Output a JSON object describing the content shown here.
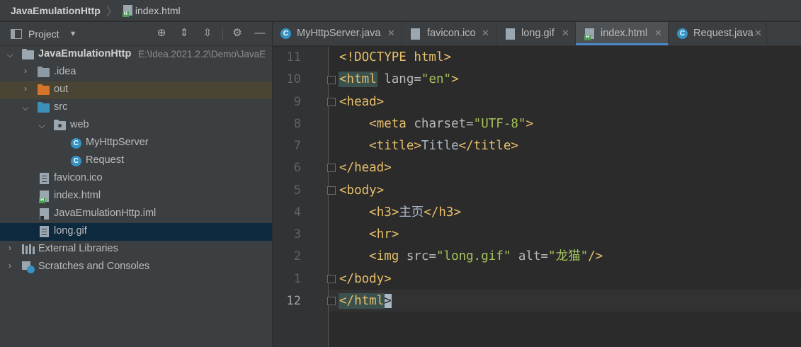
{
  "breadcrumb": {
    "project": "JavaEmulationHttp",
    "file": "index.html"
  },
  "project_panel": {
    "title": "Project",
    "tools": [
      "locate-icon",
      "expand-all-icon",
      "collapse-all-icon",
      "gear-icon",
      "minimize-icon"
    ],
    "root": {
      "name": "JavaEmulationHttp",
      "path": "E:\\Idea.2021.2.2\\Demo\\JavaE"
    },
    "items": [
      {
        "label": ".idea",
        "icon": "folder-icon"
      },
      {
        "label": "out",
        "icon": "folder-excluded-icon"
      },
      {
        "label": "src",
        "icon": "folder-source-icon"
      },
      {
        "label": "web",
        "icon": "package-icon"
      },
      {
        "label": "MyHttpServer",
        "icon": "java-class-icon"
      },
      {
        "label": "Request",
        "icon": "java-class-icon"
      },
      {
        "label": "favicon.ico",
        "icon": "image-file-icon"
      },
      {
        "label": "index.html",
        "icon": "html-file-icon"
      },
      {
        "label": "JavaEmulationHttp.iml",
        "icon": "module-file-icon"
      },
      {
        "label": "long.gif",
        "icon": "image-file-icon"
      },
      {
        "label": "External Libraries",
        "icon": "libraries-icon"
      },
      {
        "label": "Scratches and Consoles",
        "icon": "scratches-icon"
      }
    ],
    "selected": "long.gif"
  },
  "tabs": [
    {
      "label": "MyHttpServer.java",
      "icon": "java-class-icon",
      "close": "✕"
    },
    {
      "label": "favicon.ico",
      "icon": "image-file-icon",
      "close": "✕"
    },
    {
      "label": "long.gif",
      "icon": "image-file-icon",
      "close": "✕"
    },
    {
      "label": "index.html",
      "icon": "html-file-icon",
      "close": "✕",
      "active": true
    },
    {
      "label": "Request.java",
      "icon": "java-class-icon",
      "close": "✕"
    }
  ],
  "editor": {
    "line_numbers": [
      "11",
      "10",
      "9",
      "8",
      "7",
      "6",
      "5",
      "4",
      "3",
      "2",
      "1",
      "12"
    ],
    "current_line": "12",
    "lines": {
      "l1": {
        "a": "<!DOCTYPE html>"
      },
      "l2": {
        "a": "<html",
        "b": " lang=",
        "c": "\"en\"",
        "d": ">"
      },
      "l3": {
        "a": "<head>"
      },
      "l4": {
        "indent": "    ",
        "a": "<meta",
        "b": " charset=",
        "c": "\"UTF-8\"",
        "d": ">"
      },
      "l5": {
        "indent": "    ",
        "a": "<title>",
        "b": "Title",
        "c": "</title>"
      },
      "l6": {
        "a": "</head>"
      },
      "l7": {
        "a": "<body>"
      },
      "l8": {
        "indent": "    ",
        "a": "<h3>",
        "b": "主页",
        "c": "</h3>"
      },
      "l9": {
        "indent": "    ",
        "a": "<hr>"
      },
      "l10": {
        "indent": "    ",
        "a": "<img",
        "b": " src=",
        "c": "\"long.gif\"",
        "d": " alt=",
        "e": "\"龙猫\"",
        "f": "/>"
      },
      "l11": {
        "a": "</body>"
      },
      "l12": {
        "a": "</html",
        "b": ">"
      }
    }
  },
  "colors": {
    "tag": "#e8bf6a",
    "attr_value": "#a5c25c",
    "text": "#a9b7c6",
    "active_tab_underline": "#4a88c7",
    "selection": "#0d293e"
  }
}
